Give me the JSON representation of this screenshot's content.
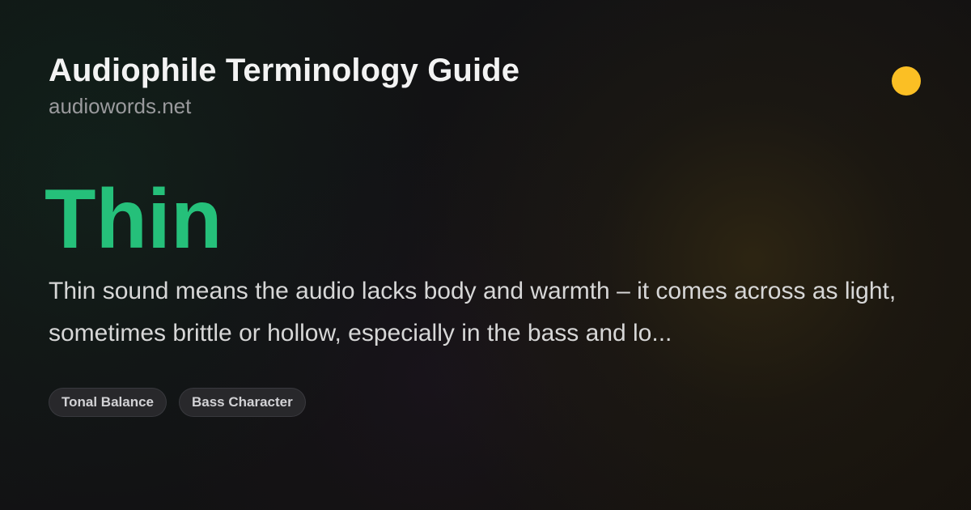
{
  "header": {
    "title": "Audiophile Terminology Guide",
    "site": "audiowords.net"
  },
  "main": {
    "term": "Thin",
    "definition": "Thin sound means the audio lacks body and warmth – it comes across as light, sometimes brittle or hollow, especially in the bass and lo..."
  },
  "tags": [
    {
      "label": "Tonal Balance"
    },
    {
      "label": "Bass Character"
    }
  ],
  "colors": {
    "accent": "#25C07A",
    "status_dot": "#FBBF24",
    "background": "#121214"
  }
}
